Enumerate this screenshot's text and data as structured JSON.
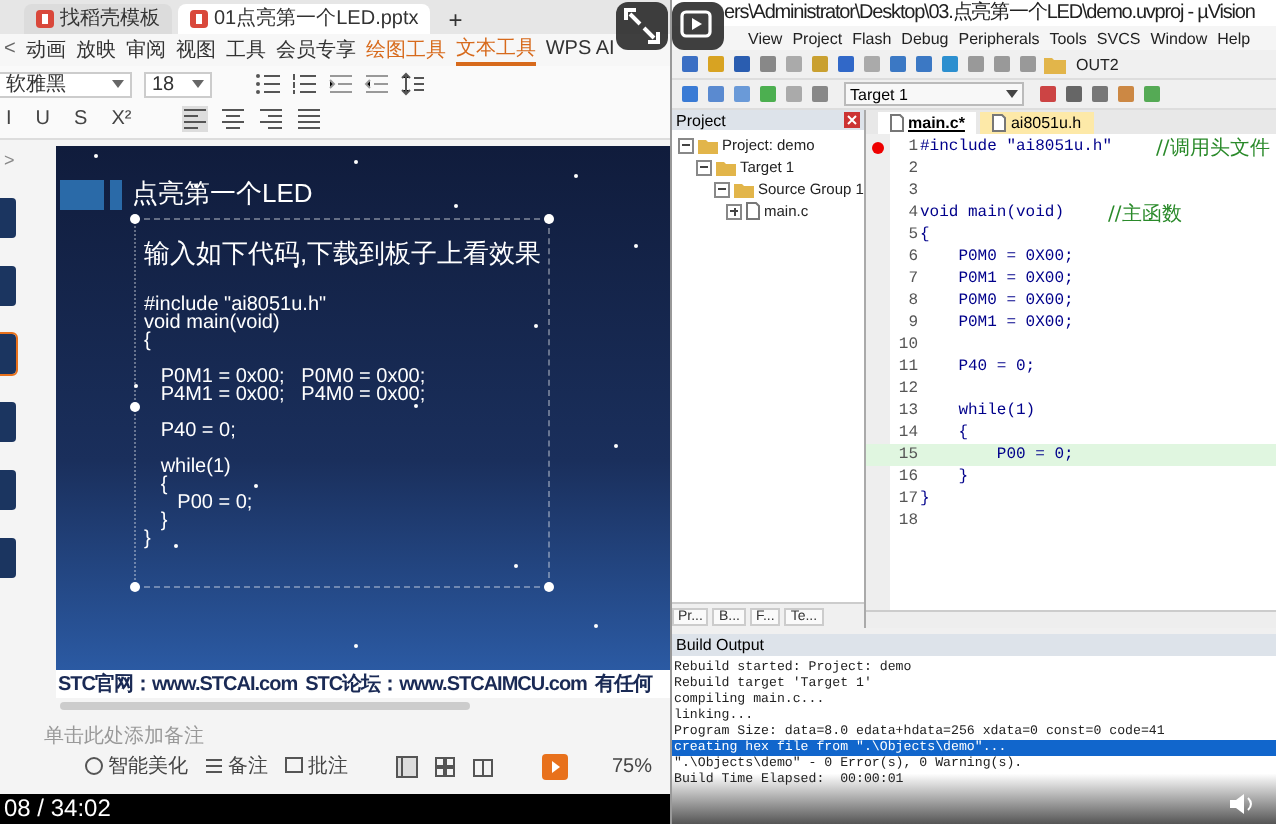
{
  "wps": {
    "tabs": [
      {
        "label": "找稻壳模板",
        "selected": false
      },
      {
        "label": "01点亮第一个LED.pptx",
        "selected": true
      }
    ],
    "new_tab": "+",
    "ribbon_scroll": "<",
    "ribbon_tabs": [
      {
        "label": "动画",
        "selected": false,
        "contextual": false
      },
      {
        "label": "放映",
        "selected": false,
        "contextual": false
      },
      {
        "label": "审阅",
        "selected": false,
        "contextual": false
      },
      {
        "label": "视图",
        "selected": false,
        "contextual": false
      },
      {
        "label": "工具",
        "selected": false,
        "contextual": false
      },
      {
        "label": "会员专享",
        "selected": false,
        "contextual": false
      },
      {
        "label": "绘图工具",
        "selected": false,
        "contextual": true
      },
      {
        "label": "文本工具",
        "selected": true,
        "contextual": true
      },
      {
        "label": "WPS AI",
        "selected": false,
        "contextual": false
      }
    ],
    "font": {
      "value": "软雅黑"
    },
    "size": {
      "value": "18"
    },
    "format_buttons": [
      "I",
      "U",
      "S",
      "X²"
    ],
    "panel_toggle": ">",
    "thumbnails": [
      {
        "selected": false
      },
      {
        "selected": false
      },
      {
        "selected": true
      },
      {
        "selected": false
      },
      {
        "selected": false
      },
      {
        "selected": false
      }
    ],
    "slide": {
      "title": "点亮第一个LED",
      "subtitle": "输入如下代码,下载到板子上看效果",
      "code_blocks": [
        [
          "#include \"ai8051u.h\"",
          "void main(void)",
          "{"
        ],
        [
          "   P0M1 = 0x00;   P0M0 = 0x00;",
          "   P4M1 = 0x00;   P4M0 = 0x00;"
        ],
        [
          "   P40 = 0;"
        ],
        [
          "   while(1)",
          "   {",
          "      P00 = 0;",
          "   }",
          "}"
        ]
      ],
      "footer": [
        "STC官网：www.STCAI.com",
        "STC论坛：www.STCAIMCU.com",
        "有任何"
      ]
    },
    "notes_placeholder": "单击此处添加备注",
    "status": [
      "智能美化",
      "备注",
      "批注"
    ],
    "zoom": "75%"
  },
  "keil": {
    "title": "ers\\Administrator\\Desktop\\03.点亮第一个LED\\demo.uvproj - µVision",
    "menu": [
      "View",
      "Project",
      "Flash",
      "Debug",
      "Peripherals",
      "Tools",
      "SVCS",
      "Window",
      "Help"
    ],
    "toolbar_field": "OUT2",
    "target": "Target 1",
    "project_header": "Project",
    "tree": [
      {
        "label": "Project: demo",
        "expanded": true,
        "children": [
          {
            "label": "Target 1",
            "expanded": true,
            "children": [
              {
                "label": "Source Group 1",
                "expanded": true,
                "children": [
                  {
                    "label": "main.c",
                    "expanded": false
                  }
                ]
              }
            ]
          }
        ]
      }
    ],
    "panel_tabs": [
      "Pr...",
      "B...",
      "F...",
      "Te..."
    ],
    "editor_tabs": [
      {
        "label": "main.c*",
        "selected": true
      },
      {
        "label": "ai8051u.h",
        "selected": false
      }
    ],
    "lines": [
      {
        "num": "1",
        "code": "#include \"ai8051u.h\"",
        "comment": "//调用头文件",
        "breakpoint": true,
        "highlighted": false
      },
      {
        "num": "2",
        "breakpoint": false,
        "highlighted": false
      },
      {
        "num": "3",
        "breakpoint": false,
        "highlighted": false
      },
      {
        "num": "4",
        "code": "void main(void)",
        "comment": "//主函数",
        "breakpoint": false,
        "highlighted": false
      },
      {
        "num": "5",
        "code": "{",
        "breakpoint": false,
        "highlighted": false
      },
      {
        "num": "6",
        "code": "    P0M0 = 0X00;",
        "breakpoint": false,
        "highlighted": false
      },
      {
        "num": "7",
        "code": "    P0M1 = 0X00;",
        "breakpoint": false,
        "highlighted": false
      },
      {
        "num": "8",
        "code": "    P0M0 = 0X00;",
        "breakpoint": false,
        "highlighted": false
      },
      {
        "num": "9",
        "code": "    P0M1 = 0X00;",
        "breakpoint": false,
        "highlighted": false
      },
      {
        "num": "10",
        "breakpoint": false,
        "highlighted": false
      },
      {
        "num": "11",
        "code": "    P40 = 0;",
        "breakpoint": false,
        "highlighted": false
      },
      {
        "num": "12",
        "breakpoint": false,
        "highlighted": false
      },
      {
        "num": "13",
        "code": "    while(1)",
        "breakpoint": false,
        "highlighted": false
      },
      {
        "num": "14",
        "code": "    {",
        "breakpoint": false,
        "highlighted": false
      },
      {
        "num": "15",
        "code": "        P00 = 0;",
        "breakpoint": false,
        "highlighted": true
      },
      {
        "num": "16",
        "code": "    }",
        "breakpoint": false,
        "highlighted": false
      },
      {
        "num": "17",
        "code": "}",
        "breakpoint": false,
        "highlighted": false
      },
      {
        "num": "18",
        "breakpoint": false,
        "highlighted": false
      }
    ],
    "build_header": "Build Output",
    "build_lines": [
      {
        "text": "Rebuild started: Project: demo",
        "selected": false
      },
      {
        "text": "Rebuild target 'Target 1'",
        "selected": false
      },
      {
        "text": "compiling main.c...",
        "selected": false
      },
      {
        "text": "linking...",
        "selected": false
      },
      {
        "text": "Program Size: data=8.0 edata+hdata=256 xdata=0 const=0 code=41",
        "selected": false
      },
      {
        "text": "creating hex file from \".\\Objects\\demo\"...",
        "selected": true
      },
      {
        "text": "\".\\Objects\\demo\" - 0 Error(s), 0 Warning(s).",
        "selected": false
      },
      {
        "text": "Build Time Elapsed:  00:00:01",
        "selected": false
      }
    ]
  },
  "video": {
    "time": "08 / 34:02"
  }
}
